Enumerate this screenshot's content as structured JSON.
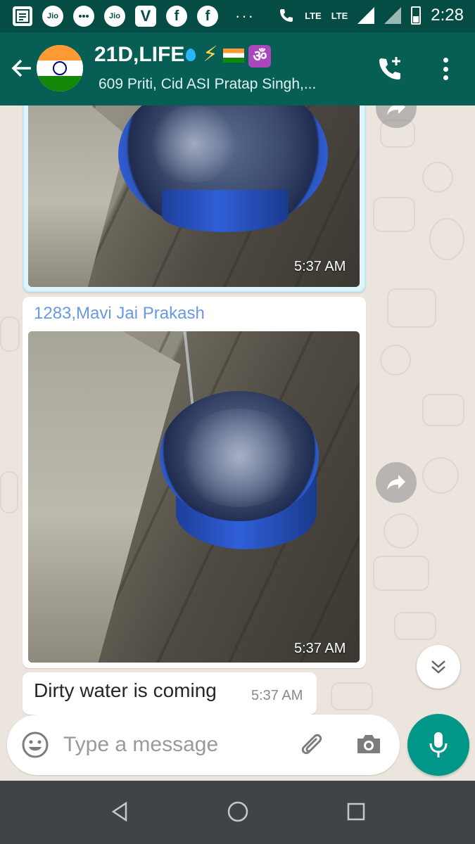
{
  "status_bar": {
    "time": "2:28",
    "network_1": "LTE",
    "network_2": "LTE",
    "notification_icons": [
      "news-icon",
      "jio-icon",
      "chat-icon",
      "jio-icon",
      "vi-icon",
      "facebook-icon",
      "facebook-icon"
    ],
    "jio_label": "Jio",
    "vi_label": "V",
    "more_dots": "···"
  },
  "header": {
    "title": "21D,LIFE",
    "subtitle": "609  Priti,  Cid ASI  Pratap Singh,...",
    "accent": "#075e54"
  },
  "messages": [
    {
      "type": "image",
      "time": "5:37 AM"
    },
    {
      "type": "image",
      "sender": "1283,Mavi Jai Prakash",
      "sender_color": "#6a98e4",
      "time": "5:37 AM"
    },
    {
      "type": "text",
      "text": "Dirty water is coming",
      "time": "5:37 AM"
    }
  ],
  "composer": {
    "placeholder": "Type a message"
  },
  "colors": {
    "chat_bg": "#ece5dd",
    "mic_button": "#009688",
    "status_bar": "#054d44"
  }
}
